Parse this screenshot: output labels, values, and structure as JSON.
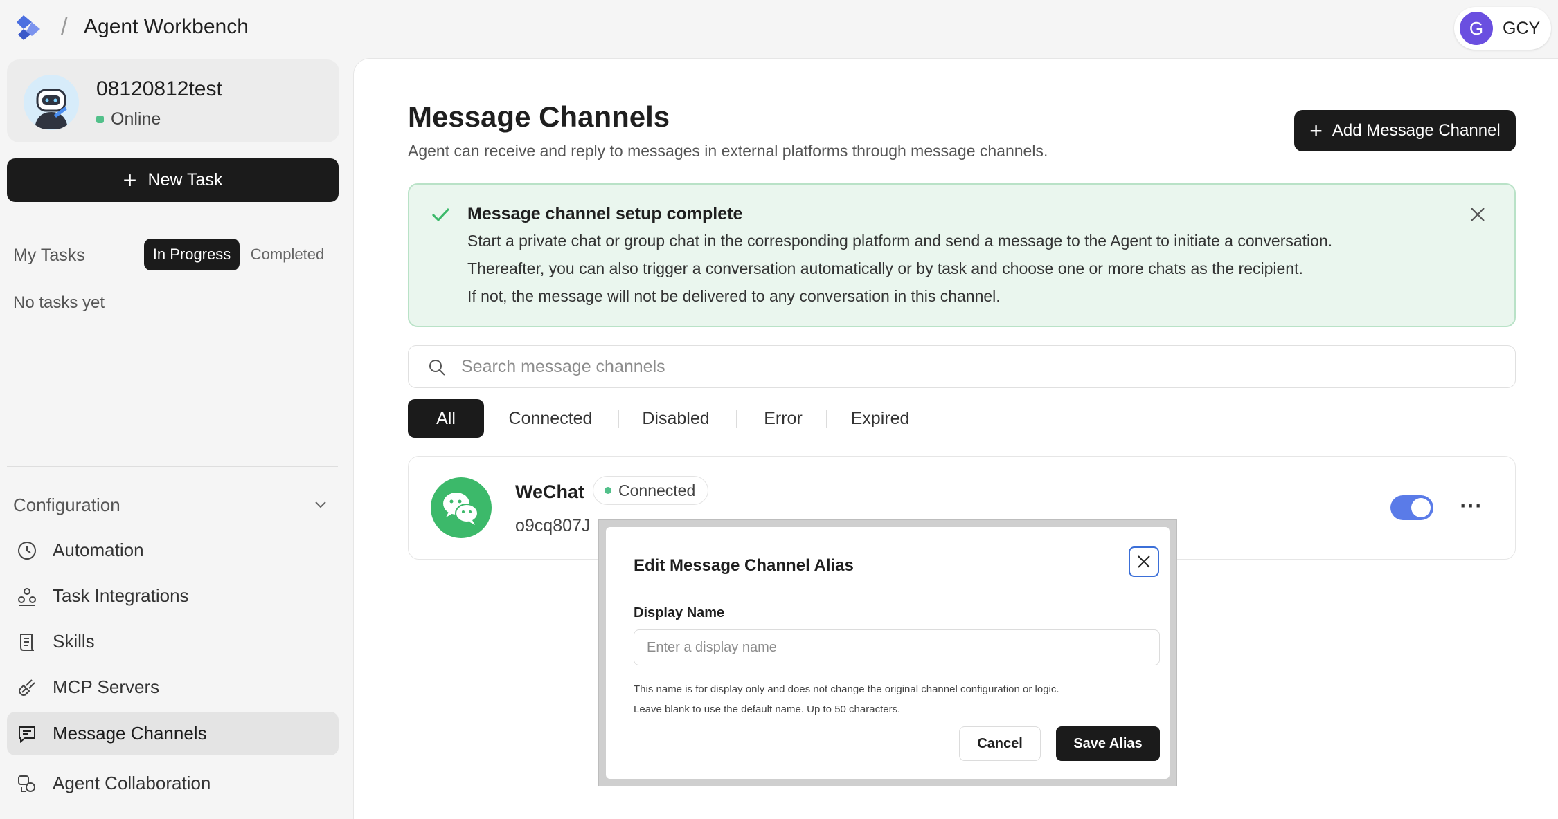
{
  "header": {
    "separator": "/",
    "title": "Agent Workbench",
    "logo_icon": "app-logo-icon",
    "user": {
      "initial": "G",
      "name": "GCY",
      "avatar_color": "#6a4fe0"
    }
  },
  "sidebar": {
    "agent": {
      "name": "08120812test",
      "status": "Online",
      "status_color": "#52c08a"
    },
    "new_task_label": "New Task",
    "tasks": {
      "heading": "My Tasks",
      "tabs": [
        {
          "label": "In Progress",
          "active": true
        },
        {
          "label": "Completed",
          "active": false
        }
      ],
      "empty_text": "No tasks yet"
    },
    "configuration": {
      "heading": "Configuration",
      "expanded": true,
      "items": [
        {
          "label": "Automation",
          "icon": "clock-icon",
          "active": false
        },
        {
          "label": "Task Integrations",
          "icon": "integrations-icon",
          "active": false
        },
        {
          "label": "Skills",
          "icon": "scroll-icon",
          "active": false
        },
        {
          "label": "MCP Servers",
          "icon": "plug-icon",
          "active": false
        },
        {
          "label": "Message Channels",
          "icon": "message-icon",
          "active": true
        },
        {
          "label": "Agent Collaboration",
          "icon": "collaboration-icon",
          "active": false
        }
      ]
    }
  },
  "main": {
    "title": "Message Channels",
    "description": "Agent can receive and reply to messages in external platforms through message channels.",
    "add_button_label": "Add Message Channel",
    "alert": {
      "title": "Message channel setup complete",
      "lines": [
        "Start a private chat or group chat in the corresponding platform and send a message to the Agent to initiate a conversation.",
        "Thereafter, you can also trigger a conversation automatically or by task and choose one or more chats as the recipient.",
        "If not, the message will not be delivered to any conversation in this channel."
      ]
    },
    "search": {
      "placeholder": "Search message channels",
      "value": ""
    },
    "filters": [
      {
        "label": "All",
        "active": true
      },
      {
        "label": "Connected",
        "active": false
      },
      {
        "label": "Disabled",
        "active": false
      },
      {
        "label": "Error",
        "active": false
      },
      {
        "label": "Expired",
        "active": false
      }
    ],
    "channels": [
      {
        "name": "WeChat",
        "status": "Connected",
        "id": "o9cq807J",
        "icon": "wechat-icon",
        "brand_color": "#3cb96a",
        "enabled": true
      }
    ]
  },
  "modal": {
    "title": "Edit Message Channel Alias",
    "field_label": "Display Name",
    "field_placeholder": "Enter a display name",
    "field_value": "",
    "hint_lines": [
      "This name is for display only and does not change the original channel configuration or logic.",
      "Leave blank to use the default name. Up to 50 characters."
    ],
    "cancel_label": "Cancel",
    "save_label": "Save Alias"
  },
  "colors": {
    "accent_dark": "#1b1b1b",
    "success": "#52c08a",
    "alert_bg": "#eaf6ee",
    "toggle_on": "#5a7be8",
    "focus_ring": "#3b6fd8"
  }
}
